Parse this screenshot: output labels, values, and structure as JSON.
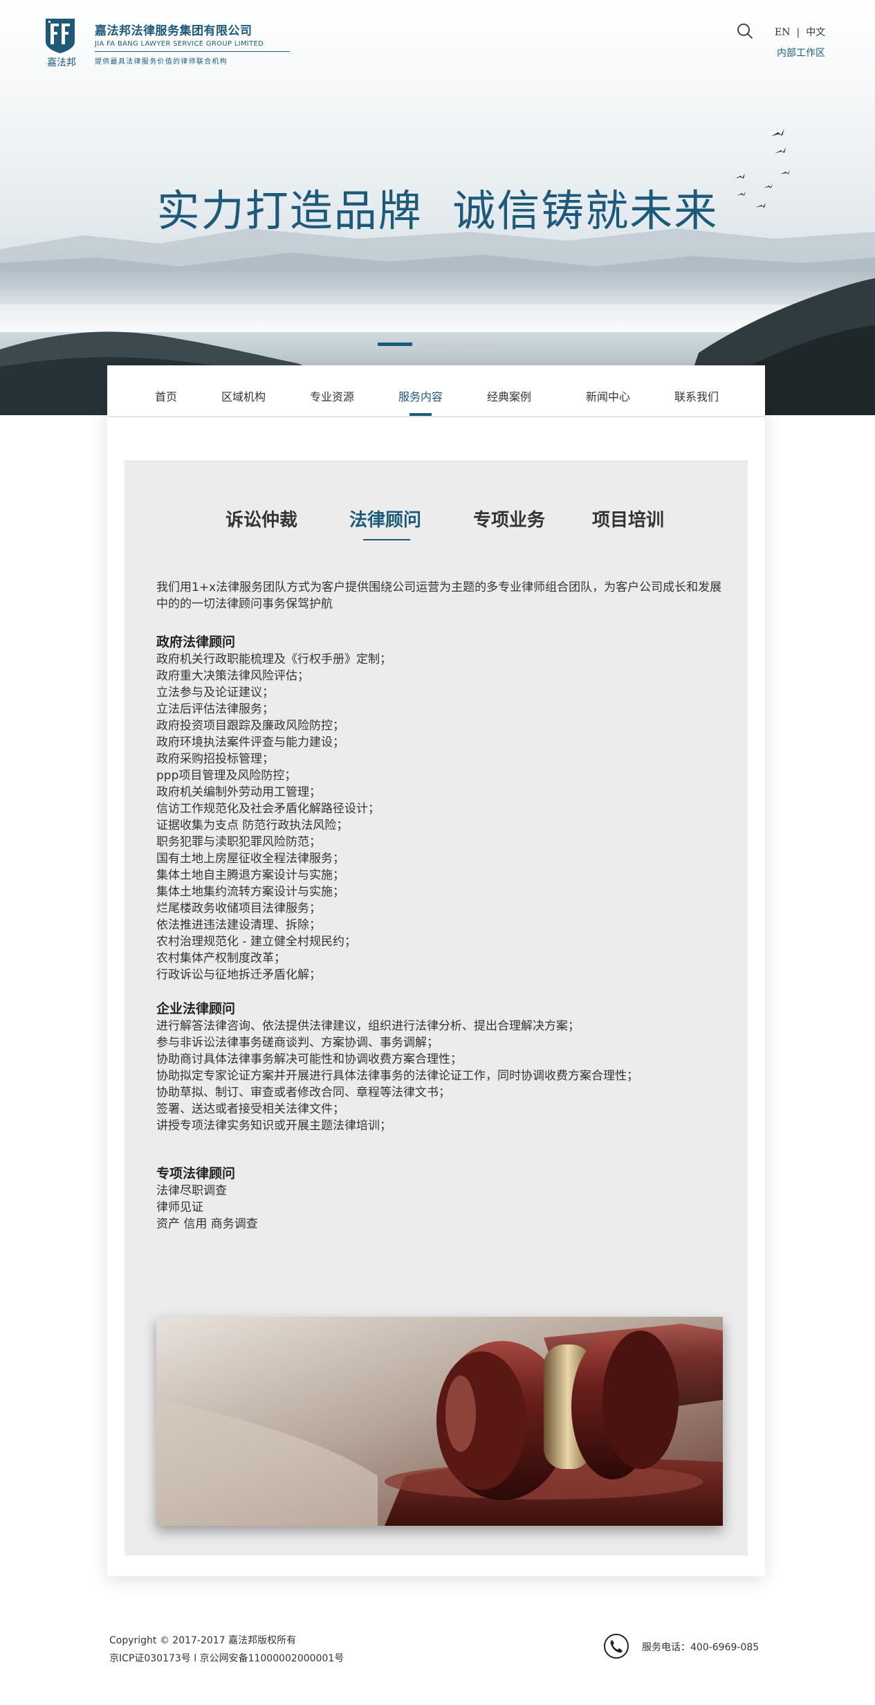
{
  "header": {
    "logo_mark_text": "嘉法邦",
    "logo_cn": "嘉法邦法律服务集团有限公司",
    "logo_en": "JIA FA BANG LAWYER SERVICE GROUP LIMITED",
    "logo_slogan": "提供最具法律服务价值的律师联合机构",
    "lang_en": "EN",
    "lang_sep": "|",
    "lang_cn": "中文",
    "internal_link": "内部工作区",
    "search_icon": "search-icon"
  },
  "banner": {
    "title": "实力打造品牌  诚信铸就未来",
    "slides": 3,
    "active_slide": 1
  },
  "nav": {
    "items": [
      "首页",
      "区域机构",
      "专业资源",
      "服务内容",
      "经典案例",
      "新闻中心",
      "联系我们"
    ],
    "active": "服务内容"
  },
  "tabs": {
    "items": [
      "诉讼仲裁",
      "法律顾问",
      "专项业务",
      "项目培训"
    ],
    "active": "法律顾问"
  },
  "intro": "我们用1+x法律服务团队方式为客户提供围绕公司运营为主题的多专业律师组合团队，为客户公司成长和发展中的的一切法律顾问事务保驾护航",
  "sections": [
    {
      "title": "政府法律顾问",
      "items": [
        "政府机关行政职能梳理及《行权手册》定制；",
        "政府重大决策法律风险评估；",
        "立法参与及论证建议；",
        "立法后评估法律服务；",
        "政府投资项目跟踪及廉政风险防控；",
        "政府环境执法案件评查与能力建设；",
        "政府采购招投标管理；",
        "ppp项目管理及风险防控；",
        "政府机关编制外劳动用工管理；",
        "信访工作规范化及社会矛盾化解路径设计；",
        "证据收集为支点 防范行政执法风险；",
        "职务犯罪与渎职犯罪风险防范；",
        "国有土地上房屋征收全程法律服务；",
        "集体土地自主腾退方案设计与实施；",
        "集体土地集约流转方案设计与实施；",
        "烂尾楼政务收储项目法律服务；",
        "依法推进违法建设清理、拆除；",
        "农村治理规范化 - 建立健全村规民约；",
        "农村集体产权制度改革；",
        "行政诉讼与征地拆迁矛盾化解；"
      ]
    },
    {
      "title": "企业法律顾问",
      "items": [
        "进行解答法律咨询、依法提供法律建议，组织进行法律分析、提出合理解决方案；",
        "参与非诉讼法律事务磋商谈判、方案协调、事务调解；",
        "协助商讨具体法律事务解决可能性和协调收费方案合理性；",
        "协助拟定专家论证方案并开展进行具体法律事务的法律论证工作，同时协调收费方案合理性；",
        "协助草拟、制订、审查或者修改合同、章程等法律文书；",
        "签署、送达或者接受相关法律文件；",
        "讲授专项法律实务知识或开展主题法律培训；"
      ]
    },
    {
      "title": "专项法律顾问",
      "items": [
        "法律尽职调查",
        "律师见证",
        "资产 信用 商务调查"
      ]
    }
  ],
  "image": {
    "subject": "gavel"
  },
  "footer": {
    "copyright": "Copyright © 2017-2017 嘉法邦版权所有",
    "icp": "京ICP证030173号 l 京公网安备11000002000001号",
    "phone_label": "服务电话：400-6969-085",
    "phone_icon": "phone-icon"
  },
  "colors": {
    "brand": "#1d5a79",
    "content_bg": "#ececec",
    "text": "#333333"
  }
}
